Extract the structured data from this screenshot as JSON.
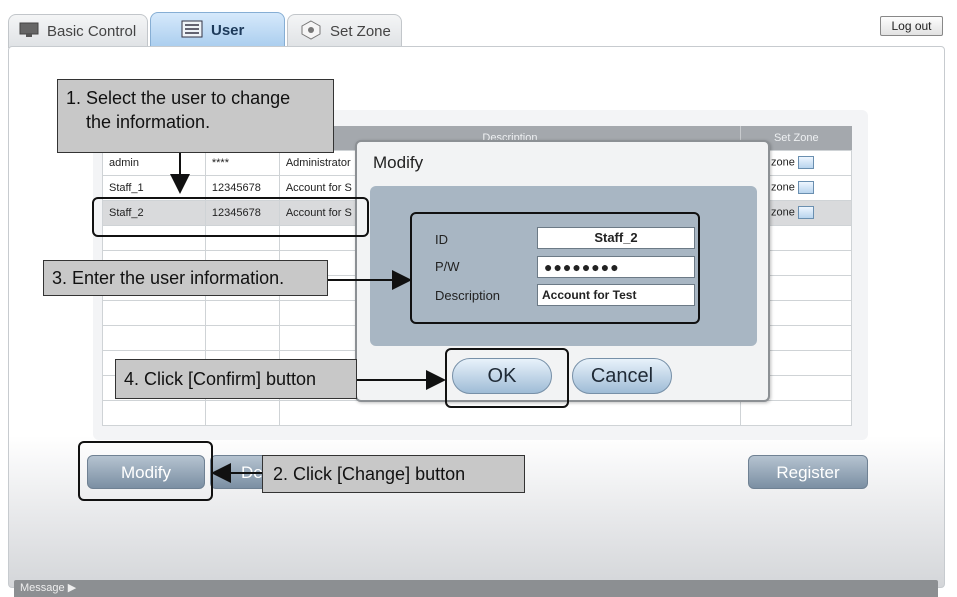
{
  "tabs": [
    {
      "label": "Basic Control",
      "icon": "monitor-icon"
    },
    {
      "label": "User",
      "icon": "list-icon"
    },
    {
      "label": "Set Zone",
      "icon": "zone-icon"
    }
  ],
  "header": {
    "logout_label": "Log out"
  },
  "table": {
    "columns": [
      "Description",
      "Set Zone"
    ],
    "rows": [
      {
        "id": "admin",
        "password": "****",
        "description": "Administrator",
        "zone": "zone"
      },
      {
        "id": "Staff_1",
        "password": "12345678",
        "description": "Account for S",
        "zone": "zone"
      },
      {
        "id": "Staff_2",
        "password": "12345678",
        "description": "Account for S",
        "zone": "zone"
      }
    ]
  },
  "buttons": {
    "modify": "Modify",
    "delete": "De",
    "register": "Register"
  },
  "modal": {
    "title": "Modify",
    "id_label": "ID",
    "id_value": "Staff_2",
    "pw_label": "P/W",
    "pw_value": "●●●●●●●●",
    "desc_label": "Description",
    "desc_value": "Account for Test",
    "ok_label": "OK",
    "cancel_label": "Cancel"
  },
  "status": {
    "message_label": "Message ▶"
  },
  "callouts": {
    "step1_line1": "1. Select the user to change",
    "step1_line2": "the information.",
    "step2": "2. Click [Change] button",
    "step3": "3. Enter the user information.",
    "step4": "4. Click [Confirm] button"
  }
}
